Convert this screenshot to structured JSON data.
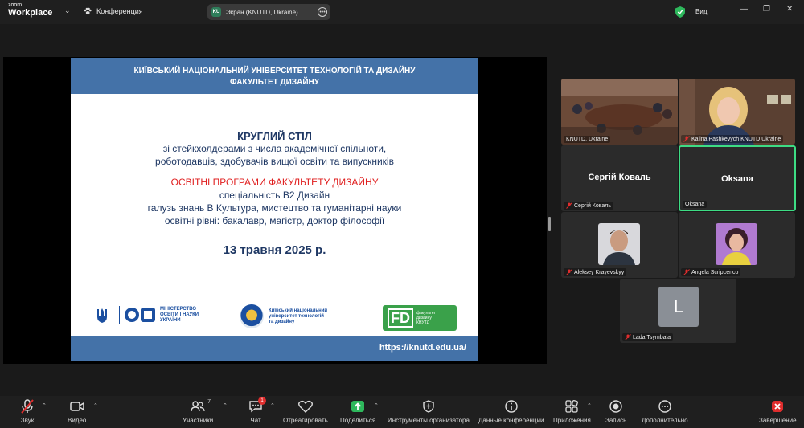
{
  "app": {
    "logo_line1": "zoom",
    "logo_line2": "Workplace"
  },
  "topbar": {
    "conference_label": "Конференция",
    "screen_share_badge": "KU",
    "screen_share_label": "Экран (KNUTD, Ukraine)",
    "view_label": "Вид"
  },
  "slide": {
    "header_line1": "КИЇВСЬКИЙ НАЦІОНАЛЬНИЙ УНІВЕРСИТЕТ  ТЕХНОЛОГІЙ ТА ДИЗАЙНУ",
    "header_line2": "ФАКУЛЬТЕТ  ДИЗАЙНУ",
    "title": "КРУГЛИЙ СТІЛ",
    "line1": "зі стейкхолдерами з числа академічної спільноти,",
    "line2": "роботодавців, здобувачів вищої освіти та випускників",
    "red_line": "ОСВІТНІ ПРОГРАМИ ФАКУЛЬТЕТУ ДИЗАЙНУ",
    "line3": "спеціальність В2 Дизайн",
    "line4": "галузь знань В Культура, мистецтво та гуманітарні науки",
    "line5": "освітні рівні: бакалавр, магістр, доктор філософії",
    "date": "13 травня  2025 р.",
    "ministry_text": [
      "МІНІСТЕРСТВО",
      "ОСВІТИ І НАУКИ",
      "УКРАЇНИ"
    ],
    "knutd_text": [
      "Київський національний",
      "університет технологій",
      "та дизайну"
    ],
    "fd_mark": "FD",
    "fd_text": [
      "факультет",
      "дизайну",
      "КНУТД"
    ],
    "url": "https://knutd.edu.ua/"
  },
  "participants": [
    {
      "name": "KNUTD, Ukraine",
      "muted": false
    },
    {
      "name": "Kalina Pashkevych KNUTD Ukraine",
      "muted": true
    },
    {
      "name": "Сергій Коваль",
      "muted": true
    },
    {
      "name": "Oksana",
      "muted": false
    },
    {
      "name": "Aleksey Krayevskyy",
      "muted": true
    },
    {
      "name": "Angela Scripcenco",
      "muted": true
    },
    {
      "name": "Lada Tsymbala",
      "muted": true,
      "avatar_letter": "L"
    }
  ],
  "toolbar": {
    "audio": "Звук",
    "video": "Видео",
    "participants": "Участники",
    "participants_count": "7",
    "chat": "Чат",
    "chat_badge": "1",
    "react": "Отреагировать",
    "share": "Поделиться",
    "host_tools": "Инструменты организатора",
    "meeting_info": "Данные конференции",
    "apps": "Приложения",
    "record": "Запись",
    "more": "Дополнительно",
    "end": "Завершение"
  },
  "colors": {
    "slide_blue": "#4472a8",
    "accent_red": "#e02020",
    "active_speaker": "#3ddc84",
    "share_green": "#2eb85c"
  }
}
